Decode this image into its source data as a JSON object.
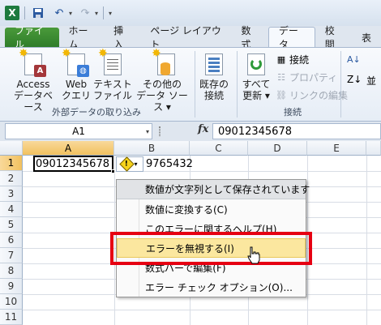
{
  "qat": {
    "app_letter": "X"
  },
  "tabs": [
    {
      "label": "ファイル"
    },
    {
      "label": "ホーム"
    },
    {
      "label": "挿入"
    },
    {
      "label": "ページ レイアウト"
    },
    {
      "label": "数式"
    },
    {
      "label": "データ"
    },
    {
      "label": "校閲"
    },
    {
      "label": "表"
    }
  ],
  "ribbon": {
    "access": {
      "line1": "Access",
      "line2": "データベース",
      "badge": "A"
    },
    "web": {
      "line1": "Web",
      "line2": "クエリ"
    },
    "text": {
      "line1": "テキスト",
      "line2": "ファイル"
    },
    "other": {
      "line1": "その他の",
      "line2": "データ ソース ▾"
    },
    "existing": {
      "line1": "既存の",
      "line2": "接続"
    },
    "group_external": "外部データの取り込み",
    "refresh": {
      "line1": "すべて",
      "line2": "更新 ▾"
    },
    "connections": "接続",
    "properties": "プロパティ",
    "edit_links": "リンクの編集",
    "group_connections": "接続",
    "sort_label": "並"
  },
  "formula_bar": {
    "name_box": "A1",
    "fx": "fx",
    "formula": "09012345678"
  },
  "grid": {
    "columns": [
      "A",
      "B",
      "C",
      "D",
      "E"
    ],
    "rows": [
      "1",
      "2",
      "3",
      "4",
      "5",
      "6",
      "7",
      "8",
      "9",
      "10",
      "11"
    ],
    "a1": "09012345678",
    "b1": "9765432"
  },
  "error_menu": {
    "title": "数値が文字列として保存されています",
    "items": [
      "数値に変換する(C)",
      "このエラーに関するヘルプ(H)",
      "エラーを無視する(I)",
      "数式バーで編集(F)",
      "エラー チェック オプション(O)..."
    ]
  },
  "colors": {
    "highlight": "#e60012",
    "file_tab": "#2f7d2a",
    "selection_header": "#f1c15f"
  }
}
